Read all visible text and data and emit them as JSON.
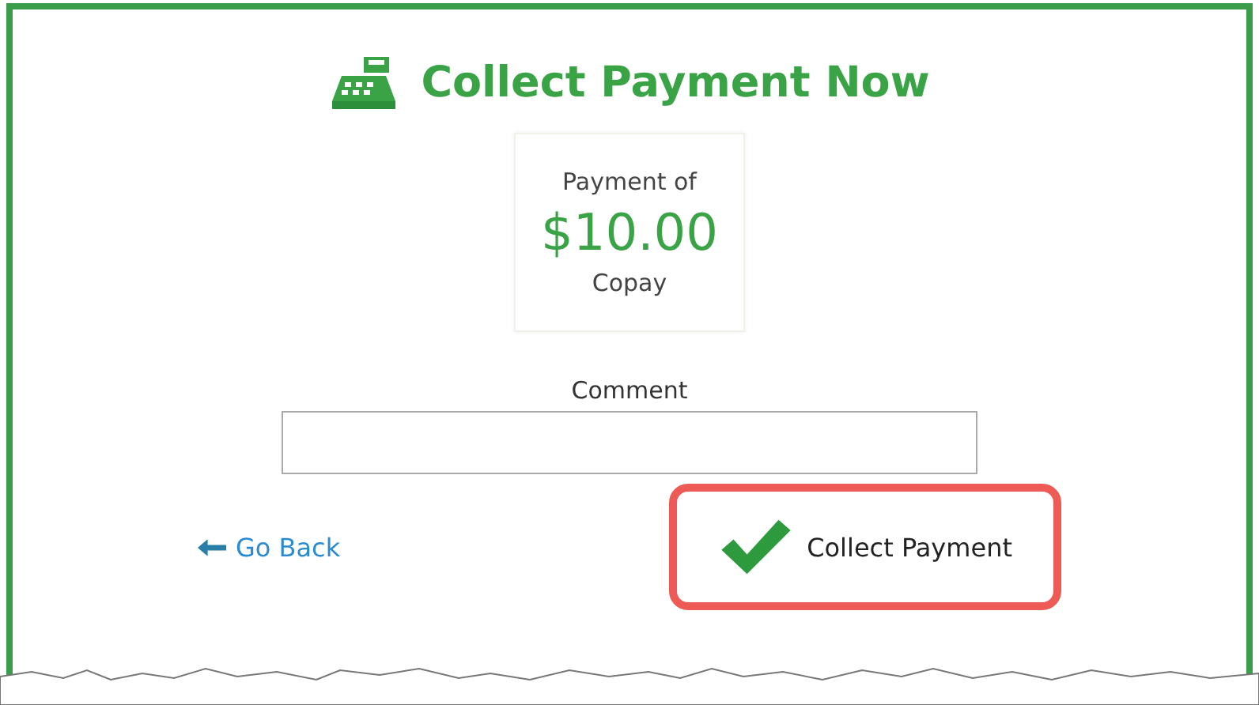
{
  "title": "Collect Payment Now",
  "payment": {
    "caption": "Payment of",
    "amount": "$10.00",
    "type": "Copay"
  },
  "comment": {
    "label": "Comment"
  },
  "back_link": "Go Back",
  "collect_button": {
    "label": "Collect Payment",
    "highlighted": true
  }
}
